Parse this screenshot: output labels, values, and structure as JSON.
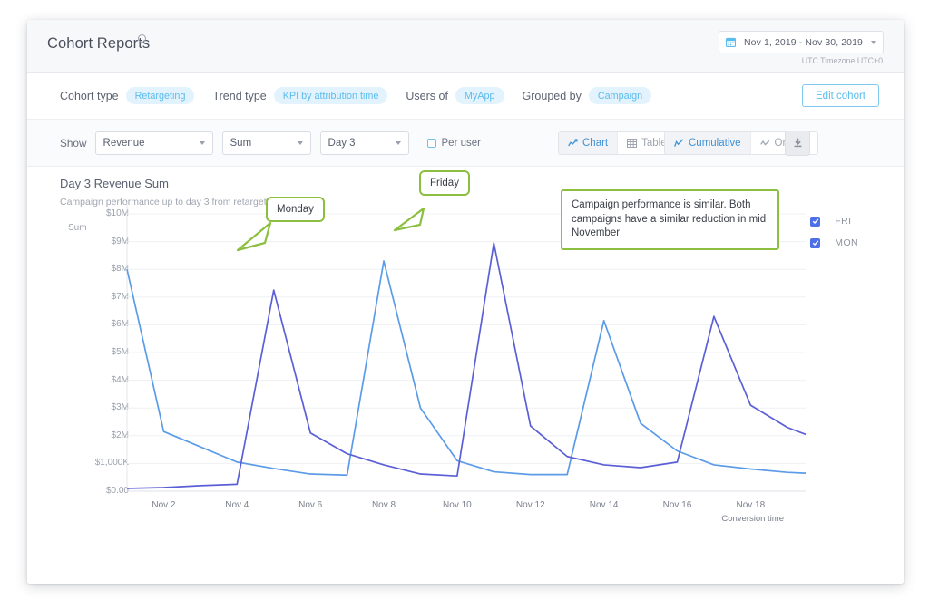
{
  "header": {
    "title": "Cohort Reports",
    "info_icon": "info-icon",
    "date_range": "Nov 1, 2019 - Nov 30, 2019",
    "calendar_icon": "calendar-icon",
    "timezone": "UTC Timezone UTC+0"
  },
  "filters": {
    "cohort_type_label": "Cohort type",
    "cohort_type_value": "Retargeting",
    "trend_type_label": "Trend type",
    "trend_type_value": "KPI by attribution time",
    "users_of_label": "Users of",
    "users_of_value": "MyApp",
    "grouped_by_label": "Grouped by",
    "grouped_by_value": "Campaign",
    "edit_button": "Edit cohort"
  },
  "controls": {
    "show_label": "Show",
    "metric": "Revenue",
    "aggregation": "Sum",
    "day": "Day 3",
    "per_user_label": "Per user",
    "per_user_checked": false,
    "view_chart": "Chart",
    "view_table": "Table",
    "mode_cumulative": "Cumulative",
    "mode_on_day": "On day",
    "download_icon": "download-icon",
    "chart_icon": "chart-icon",
    "table_icon": "table-icon",
    "cumulative_icon": "cumulative-icon",
    "onday-icon": "onday-icon"
  },
  "colors": {
    "accent_blue": "#5bbcee",
    "series_fri": "#5b9be8",
    "series_mon": "#5b5fd6",
    "callout_green": "#8cbf3f",
    "legend_check": "#4d6fe8"
  },
  "annotations": [
    {
      "id": "monday-callout",
      "text": "Monday"
    },
    {
      "id": "friday-callout",
      "text": "Friday"
    },
    {
      "id": "note-callout",
      "text": "Campaign performance is similar. Both campaigns have a similar reduction in mid November"
    }
  ],
  "chart_data": {
    "type": "line",
    "title": "Day 3 Revenue Sum",
    "subtitle": "Campaign performance up to day 3 from retargeting day",
    "ylabel": "Sum",
    "xlabel": "Conversion time",
    "grid": true,
    "legend_position": "right",
    "ytick_labels": [
      "$10M",
      "$9M",
      "$8M",
      "$7M",
      "$6M",
      "$5M",
      "$4M",
      "$3M",
      "$2M",
      "$1,000K",
      "$0.00"
    ],
    "ytick_values": [
      10,
      9,
      8,
      7,
      6,
      5,
      4,
      3,
      2,
      1,
      0
    ],
    "ylim": [
      0,
      10
    ],
    "xtick_labels": [
      "Nov 2",
      "Nov 4",
      "Nov 6",
      "Nov 8",
      "Nov 10",
      "Nov 12",
      "Nov 14",
      "Nov 16",
      "Nov 18"
    ],
    "xtick_values": [
      2,
      4,
      6,
      8,
      10,
      12,
      14,
      16,
      18
    ],
    "xlim": [
      1,
      19.5
    ],
    "x": [
      1,
      2,
      3,
      4,
      5,
      6,
      7,
      8,
      9,
      10,
      11,
      12,
      13,
      14,
      15,
      16,
      17,
      18,
      19,
      19.5
    ],
    "series": [
      {
        "name": "FRI",
        "color": "#5b9be8",
        "values": [
          8.0,
          2.15,
          1.6,
          1.05,
          0.82,
          0.62,
          0.58,
          8.3,
          3.0,
          1.1,
          0.7,
          0.6,
          0.6,
          6.15,
          2.45,
          1.45,
          0.95,
          0.8,
          0.68,
          0.65
        ]
      },
      {
        "name": "MON",
        "color": "#5b5fd6",
        "values": [
          0.1,
          0.13,
          0.2,
          0.25,
          7.25,
          2.1,
          1.35,
          0.95,
          0.62,
          0.55,
          8.95,
          2.35,
          1.25,
          0.95,
          0.85,
          1.05,
          6.3,
          3.1,
          2.3,
          2.05
        ]
      }
    ]
  }
}
